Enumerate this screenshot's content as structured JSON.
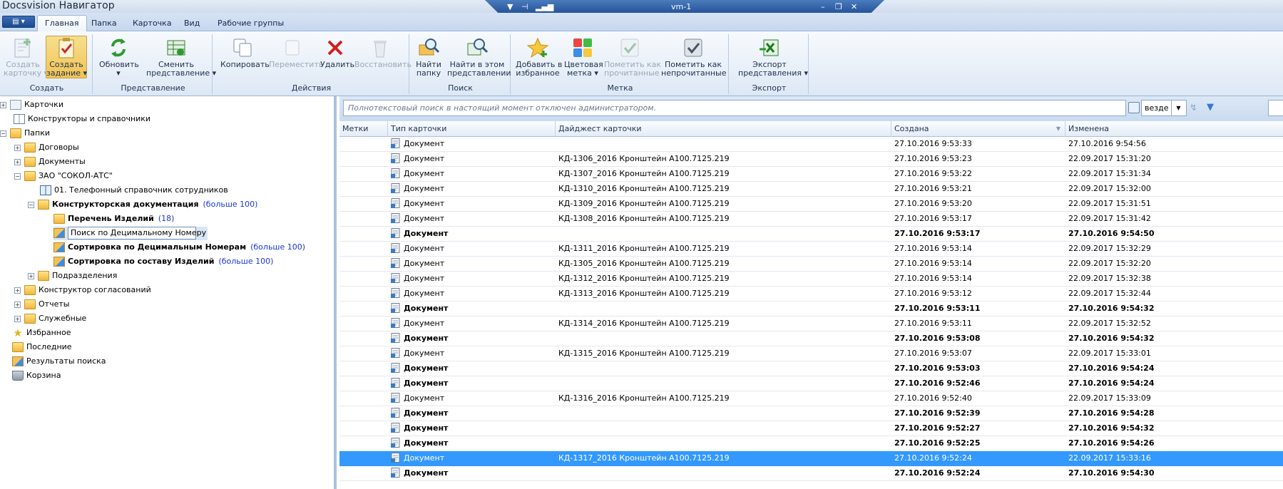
{
  "window": {
    "title": "Docsvision Навигатор",
    "remote_host": "vm-1"
  },
  "tabs": [
    "Главная",
    "Папка",
    "Карточка",
    "Вид",
    "Рабочие группы"
  ],
  "ribbon": {
    "groups": [
      {
        "label": "Создать",
        "buttons": [
          {
            "label": "Создать карточку",
            "disabled": true
          },
          {
            "label": "Создать задание",
            "pressed": true
          }
        ]
      },
      {
        "label": "Представление",
        "buttons": [
          {
            "label": "Обновить"
          },
          {
            "label": "Сменить представление"
          }
        ]
      },
      {
        "label": "Действия",
        "buttons": [
          {
            "label": "Копировать"
          },
          {
            "label": "Переместить",
            "disabled": true
          },
          {
            "label": "Удалить"
          },
          {
            "label": "Восстановить",
            "disabled": true
          }
        ]
      },
      {
        "label": "Поиск",
        "buttons": [
          {
            "label": "Найти папку"
          },
          {
            "label": "Найти в этом представлении"
          }
        ]
      },
      {
        "label": "Метка",
        "buttons": [
          {
            "label": "Добавить в избранное"
          },
          {
            "label": "Цветовая метка"
          },
          {
            "label": "Пометить как прочитанные",
            "disabled": true
          },
          {
            "label": "Пометить как непрочитанные"
          }
        ]
      },
      {
        "label": "Экспорт",
        "buttons": [
          {
            "label": "Экспорт представления"
          }
        ]
      }
    ]
  },
  "tree": {
    "nodes": [
      {
        "label": "Карточки",
        "level": 0,
        "exp": "+"
      },
      {
        "label": "Конструкторы и справочники",
        "level": 0
      },
      {
        "label": "Папки",
        "level": 0,
        "exp": "-"
      },
      {
        "label": "Договоры",
        "level": 1,
        "exp": "+"
      },
      {
        "label": "Документы",
        "level": 1,
        "exp": "+"
      },
      {
        "label": "ЗАО \"СОКОЛ-АТС\"",
        "level": 1,
        "exp": "-"
      },
      {
        "label": "01. Телефонный справочник сотрудников",
        "level": 2
      },
      {
        "label": "Конструкторская документация",
        "level": 2,
        "exp": "-",
        "bold": true,
        "count": "(больше 100)"
      },
      {
        "label": "Перечень Изделий",
        "level": 3,
        "bold": true,
        "count": "(18)"
      },
      {
        "label": "Поиск по Децимальному Номеру",
        "level": 3,
        "editing": true
      },
      {
        "label": "Сортировка по Децимальным Номерам",
        "level": 3,
        "bold": true,
        "count": "(больше 100)"
      },
      {
        "label": "Сортировка по составу Изделий",
        "level": 3,
        "bold": true,
        "count": "(больше 100)"
      },
      {
        "label": "Подразделения",
        "level": 2,
        "exp": "+"
      },
      {
        "label": "Конструктор согласований",
        "level": 1,
        "exp": "+"
      },
      {
        "label": "Отчеты",
        "level": 1,
        "exp": "+"
      },
      {
        "label": "Служебные",
        "level": 1,
        "exp": "+"
      },
      {
        "label": "Избранное",
        "level": 0
      },
      {
        "label": "Последние",
        "level": 0
      },
      {
        "label": "Результаты поиска",
        "level": 0
      },
      {
        "label": "Корзина",
        "level": 0
      }
    ]
  },
  "search": {
    "placeholder": "Полнотекстовый поиск в настоящий момент отключен администратором.",
    "scope": "везде"
  },
  "grid": {
    "columns": [
      "Метки",
      "Тип карточки",
      "Дайджест карточки",
      "Создана",
      "Изменена"
    ],
    "rows": [
      {
        "type": "Документ",
        "digest": "",
        "created": "27.10.2016 9:53:33",
        "modified": "27.10.2016 9:54:56"
      },
      {
        "type": "Документ",
        "digest": "КД-1306_2016 Кронштейн А100.7125.219",
        "created": "27.10.2016 9:53:23",
        "modified": "22.09.2017 15:31:20"
      },
      {
        "type": "Документ",
        "digest": "КД-1307_2016 Кронштейн А100.7125.219",
        "created": "27.10.2016 9:53:22",
        "modified": "22.09.2017 15:31:34"
      },
      {
        "type": "Документ",
        "digest": "КД-1310_2016 Кронштейн А100.7125.219",
        "created": "27.10.2016 9:53:21",
        "modified": "22.09.2017 15:32:00"
      },
      {
        "type": "Документ",
        "digest": "КД-1309_2016 Кронштейн А100.7125.219",
        "created": "27.10.2016 9:53:20",
        "modified": "22.09.2017 15:31:51"
      },
      {
        "type": "Документ",
        "digest": "КД-1308_2016 Кронштейн А100.7125.219",
        "created": "27.10.2016 9:53:17",
        "modified": "22.09.2017 15:31:42"
      },
      {
        "type": "Документ",
        "digest": "",
        "created": "27.10.2016 9:53:17",
        "modified": "27.10.2016 9:54:50",
        "bold": true
      },
      {
        "type": "Документ",
        "digest": "КД-1311_2016 Кронштейн А100.7125.219",
        "created": "27.10.2016 9:53:14",
        "modified": "22.09.2017 15:32:29"
      },
      {
        "type": "Документ",
        "digest": "КД-1305_2016 Кронштейн А100.7125.219",
        "created": "27.10.2016 9:53:14",
        "modified": "22.09.2017 15:32:20"
      },
      {
        "type": "Документ",
        "digest": "КД-1312_2016 Кронштейн А100.7125.219",
        "created": "27.10.2016 9:53:14",
        "modified": "22.09.2017 15:32:38"
      },
      {
        "type": "Документ",
        "digest": "КД-1313_2016 Кронштейн А100.7125.219",
        "created": "27.10.2016 9:53:12",
        "modified": "22.09.2017 15:32:44"
      },
      {
        "type": "Документ",
        "digest": "",
        "created": "27.10.2016 9:53:11",
        "modified": "27.10.2016 9:54:32",
        "bold": true
      },
      {
        "type": "Документ",
        "digest": "КД-1314_2016 Кронштейн А100.7125.219",
        "created": "27.10.2016 9:53:11",
        "modified": "22.09.2017 15:32:52"
      },
      {
        "type": "Документ",
        "digest": "",
        "created": "27.10.2016 9:53:08",
        "modified": "27.10.2016 9:54:32",
        "bold": true
      },
      {
        "type": "Документ",
        "digest": "КД-1315_2016 Кронштейн А100.7125.219",
        "created": "27.10.2016 9:53:07",
        "modified": "22.09.2017 15:33:01"
      },
      {
        "type": "Документ",
        "digest": "",
        "created": "27.10.2016 9:53:03",
        "modified": "27.10.2016 9:54:24",
        "bold": true
      },
      {
        "type": "Документ",
        "digest": "",
        "created": "27.10.2016 9:52:46",
        "modified": "27.10.2016 9:54:24",
        "bold": true
      },
      {
        "type": "Документ",
        "digest": "КД-1316_2016 Кронштейн А100.7125.219",
        "created": "27.10.2016 9:52:40",
        "modified": "22.09.2017 15:33:09"
      },
      {
        "type": "Документ",
        "digest": "",
        "created": "27.10.2016 9:52:39",
        "modified": "27.10.2016 9:54:28",
        "bold": true
      },
      {
        "type": "Документ",
        "digest": "",
        "created": "27.10.2016 9:52:27",
        "modified": "27.10.2016 9:54:32",
        "bold": true
      },
      {
        "type": "Документ",
        "digest": "",
        "created": "27.10.2016 9:52:25",
        "modified": "27.10.2016 9:54:26",
        "bold": true
      },
      {
        "type": "Документ",
        "digest": "КД-1317_2016 Кронштейн А100.7125.219",
        "created": "27.10.2016 9:52:24",
        "modified": "22.09.2017 15:33:16",
        "selected": true
      },
      {
        "type": "Документ",
        "digest": "",
        "created": "27.10.2016 9:52:24",
        "modified": "27.10.2016 9:54:30",
        "bold": true
      }
    ]
  },
  "colors": {
    "accent": "#3399ff",
    "ribbon": "#dde8f5",
    "count_link": "#1a35d8"
  }
}
